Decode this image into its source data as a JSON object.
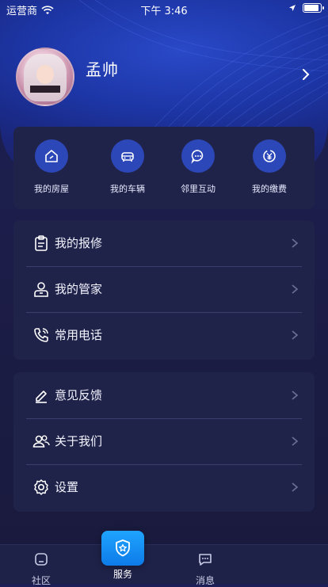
{
  "status_bar": {
    "carrier": "运营商",
    "time": "下午 3:46"
  },
  "profile": {
    "name": "孟帅"
  },
  "quick_actions": [
    {
      "label": "我的房屋",
      "icon": "house-icon"
    },
    {
      "label": "我的车辆",
      "icon": "car-icon"
    },
    {
      "label": "邻里互动",
      "icon": "chat-icon"
    },
    {
      "label": "我的缴费",
      "icon": "payment-icon"
    }
  ],
  "menu_group_1": [
    {
      "label": "我的报修",
      "icon": "clipboard-icon"
    },
    {
      "label": "我的管家",
      "icon": "person-icon"
    },
    {
      "label": "常用电话",
      "icon": "phone-icon"
    }
  ],
  "menu_group_2": [
    {
      "label": "意见反馈",
      "icon": "edit-icon"
    },
    {
      "label": "关于我们",
      "icon": "users-icon"
    },
    {
      "label": "设置",
      "icon": "gear-icon"
    }
  ],
  "tabbar": {
    "community": "社区",
    "service": "服务",
    "messages": "消息"
  },
  "colors": {
    "accent": "#2c47b8",
    "card": "#202349",
    "service_button": "#1fa4ff"
  }
}
